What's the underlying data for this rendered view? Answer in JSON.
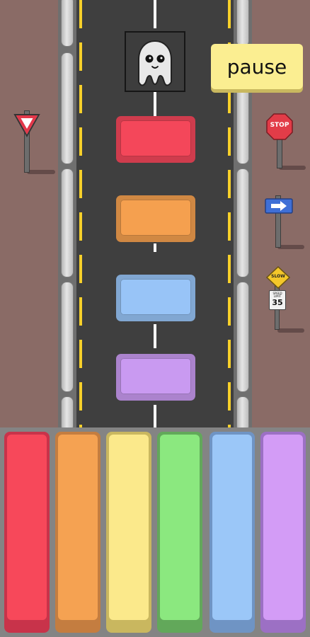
{
  "hud": {
    "pause_label": "pause"
  },
  "player": {
    "icon": "ghost-icon"
  },
  "falling_blocks": [
    {
      "color_name": "red",
      "color": "#f4475a"
    },
    {
      "color_name": "orange",
      "color": "#f5a04f"
    },
    {
      "color_name": "blue",
      "color": "#98c4f7"
    },
    {
      "color_name": "purple",
      "color": "#c99af1"
    }
  ],
  "keys": [
    {
      "color_name": "red",
      "color": "#f7485a",
      "shade": "#c8334a"
    },
    {
      "color_name": "orange",
      "color": "#f5a252",
      "shade": "#c47d40"
    },
    {
      "color_name": "yellow",
      "color": "#fbe98b",
      "shade": "#c9b75f"
    },
    {
      "color_name": "green",
      "color": "#8be87f",
      "shade": "#62a85a"
    },
    {
      "color_name": "blue",
      "color": "#9bc7f8",
      "shade": "#6f94c4"
    },
    {
      "color_name": "purple",
      "color": "#d39cf6",
      "shade": "#9c70c4"
    }
  ],
  "signs": {
    "stop": "STOP",
    "slow": "SLOW",
    "speed_limit": {
      "label": "SPEED LIMIT",
      "value": "35"
    },
    "yield": "yield-sign",
    "direction": "arrow-right-icon"
  },
  "colors": {
    "road": "#3f3f3f",
    "lane_yellow": "#f7d02a",
    "ground": "#8a6b66",
    "panel": "#848484"
  }
}
